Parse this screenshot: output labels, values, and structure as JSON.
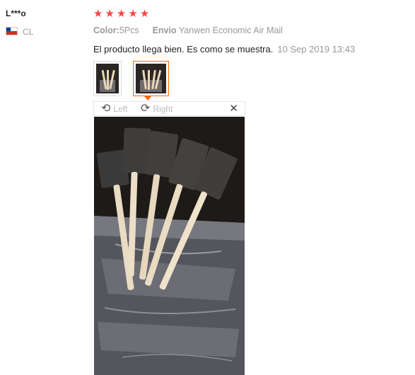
{
  "review": {
    "user_name": "L***o",
    "country": "CL",
    "rating": 5,
    "star_color": "#ff4444",
    "attributes": {
      "color_label": "Color:",
      "color_value": "5Pcs",
      "shipping_label": "Envio",
      "shipping_value": "Yanwen Economic Air Mail"
    },
    "text": "El producto llega bien. Es como se muestra.",
    "date": "10 Sep 2019 13:43",
    "thumbnails": 2,
    "selected_thumbnail": 2
  },
  "viewer": {
    "rotate_left_label": "Left",
    "rotate_right_label": "Right",
    "close_icon": "close-icon"
  },
  "colors": {
    "accent": "#ff6600",
    "muted_text": "#999999"
  }
}
